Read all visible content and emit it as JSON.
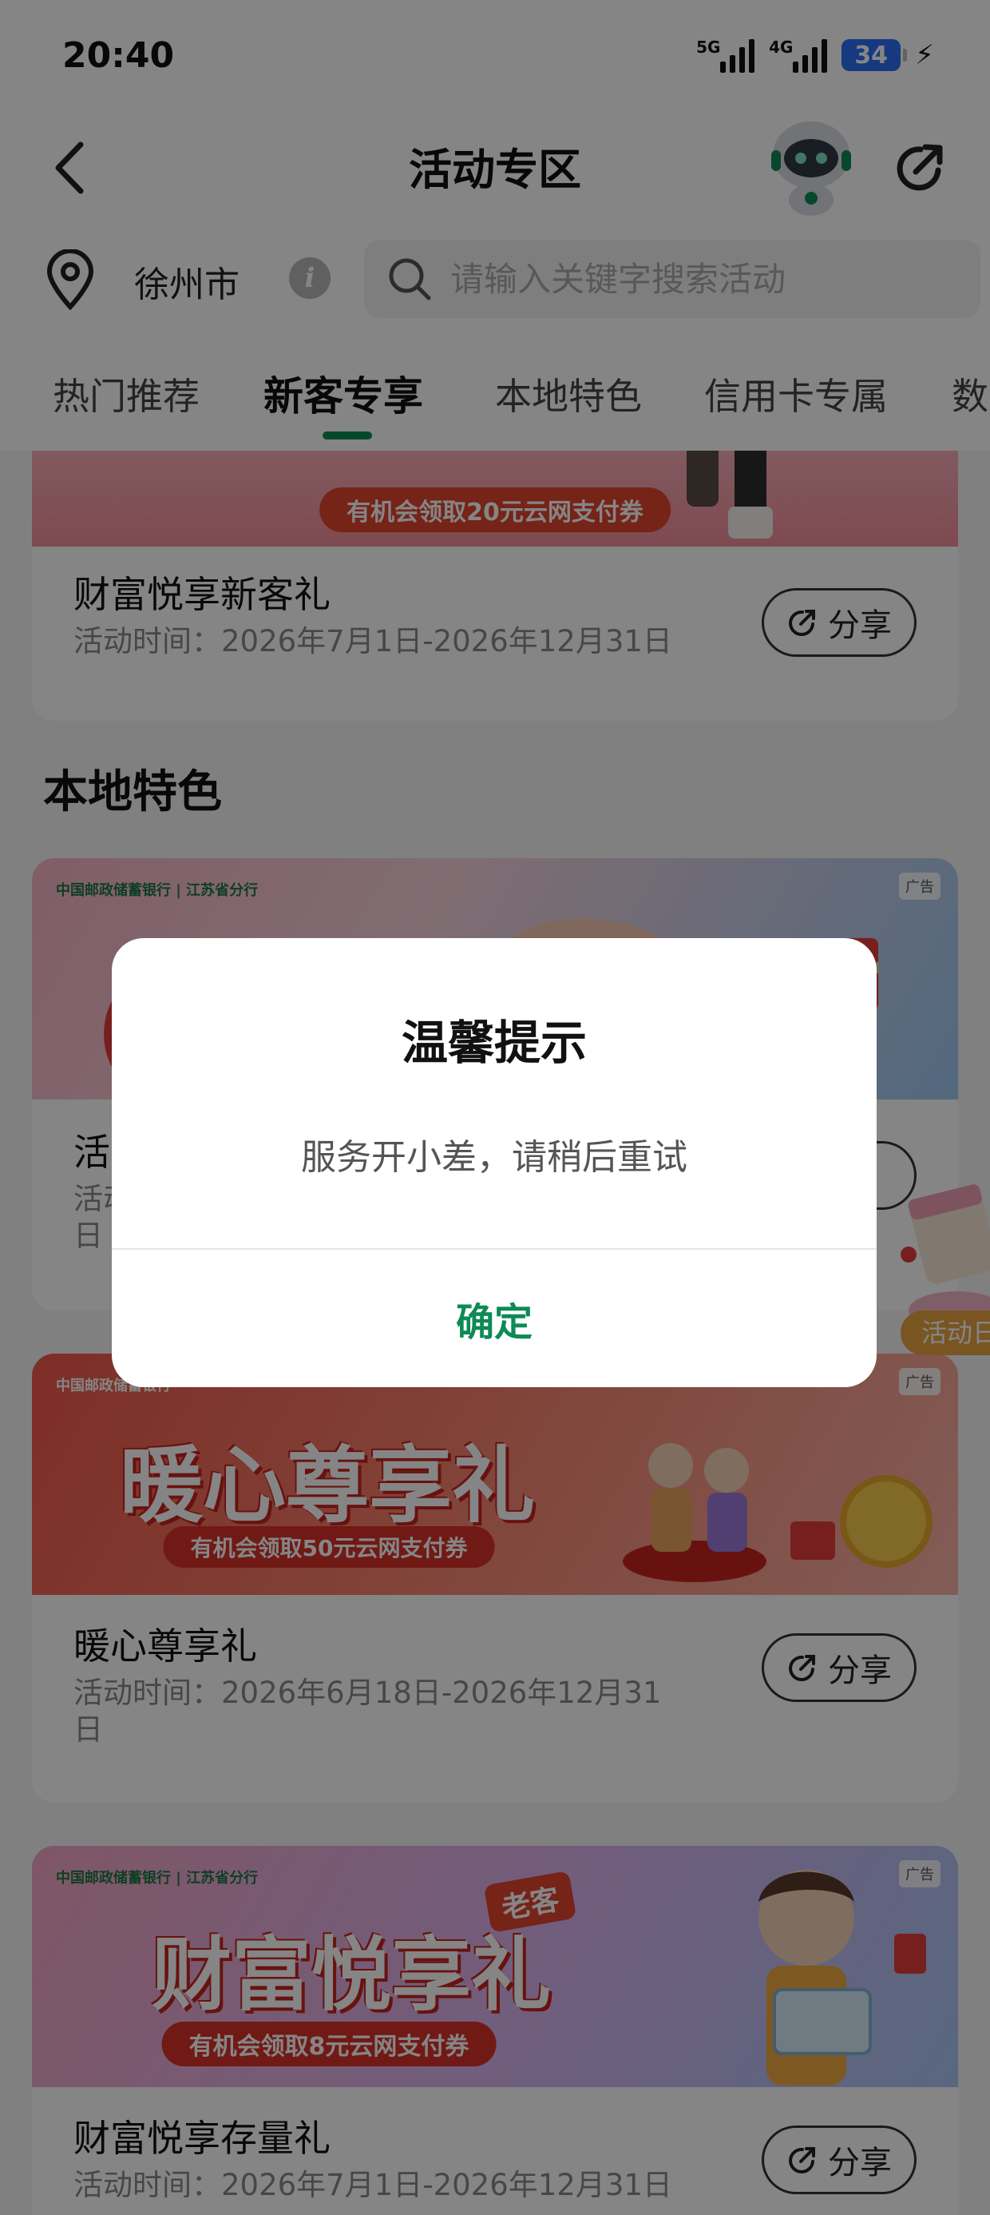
{
  "status_bar": {
    "time": "20:40",
    "signal1_label": "5G",
    "signal2_label": "4G",
    "battery": "34",
    "charging_icon": "bolt-icon"
  },
  "header": {
    "title": "活动专区",
    "back_icon": "chevron-left-icon",
    "assistant_icon": "robot-avatar-icon",
    "share_icon": "share-arrow-icon"
  },
  "location": {
    "city": "徐州市",
    "info_icon": "info-icon"
  },
  "search": {
    "placeholder": "请输入关键字搜索活动"
  },
  "tabs": [
    {
      "label": "热门推荐",
      "active": false
    },
    {
      "label": "新客专享",
      "active": true
    },
    {
      "label": "本地特色",
      "active": false
    },
    {
      "label": "信用卡专属",
      "active": false
    },
    {
      "label": "数",
      "active": false
    }
  ],
  "cards": [
    {
      "banner_text": "",
      "banner_pill": "有机会领取20元云网支付券",
      "title": "财富悦享新客礼",
      "time": "活动时间：2026年7月1日-2026年12月31日",
      "share_label": "分享"
    }
  ],
  "local_section": {
    "title": "本地特色",
    "cards": [
      {
        "bank_logo": "中国邮政储蓄银行 | 江苏省分行",
        "ad_tag": "广告",
        "title": "活",
        "time": "活动",
        "time_line2": "日",
        "share_label": "享"
      },
      {
        "bank_logo": "中国邮政储蓄银行",
        "ad_tag": "广告",
        "banner_text": "暖心尊享礼",
        "banner_pill": "有机会领取50元云网支付券",
        "title": "暖心尊享礼",
        "time": "活动时间：2026年6月18日-2026年12月31日",
        "share_label": "分享"
      },
      {
        "bank_logo": "中国邮政储蓄银行 | 江苏省分行",
        "ad_tag": "广告",
        "banner_text": "财富悦享礼",
        "banner_badge": "老客",
        "banner_pill": "有机会领取8元云网支付券",
        "title": "财富悦享存量礼",
        "time": "活动时间：2026年7月1日-2026年12月31日",
        "share_label": "分享"
      }
    ]
  },
  "floating": {
    "label": "活动日"
  },
  "dialog": {
    "title": "温馨提示",
    "message": "服务开小差，请稍后重试",
    "confirm_label": "确定"
  },
  "colors": {
    "accent_green": "#0e8a55",
    "battery_blue": "#2b6ef5",
    "banner_red": "#e2432f"
  }
}
